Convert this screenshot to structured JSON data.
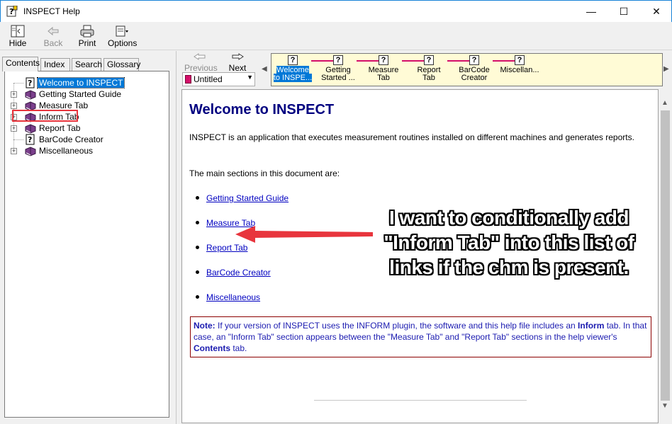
{
  "window": {
    "title": "INSPECT Help",
    "minimize": "—",
    "maximize": "☐",
    "close": "✕"
  },
  "toolbar": {
    "hide": "Hide",
    "back": "Back",
    "print": "Print",
    "options": "Options"
  },
  "left_tabs": [
    "Contents",
    "Index",
    "Search",
    "Glossary"
  ],
  "tree": [
    {
      "label": "Welcome to INSPECT",
      "icon": "page-icon",
      "selected": true
    },
    {
      "label": "Getting Started Guide",
      "icon": "book-icon"
    },
    {
      "label": "Measure Tab",
      "icon": "book-icon"
    },
    {
      "label": "Inform Tab",
      "icon": "book-icon"
    },
    {
      "label": "Report Tab",
      "icon": "book-icon"
    },
    {
      "label": "BarCode Creator",
      "icon": "page-icon"
    },
    {
      "label": "Miscellaneous",
      "icon": "book-icon"
    }
  ],
  "nav": {
    "previous": "Previous",
    "next": "Next",
    "untitled": "Untitled"
  },
  "breadcrumbs": [
    {
      "line1": "Welcome",
      "line2": "to INSPE..."
    },
    {
      "line1": "Getting",
      "line2": "Started ..."
    },
    {
      "line1": "Measure",
      "line2": "Tab"
    },
    {
      "line1": "Report",
      "line2": "Tab"
    },
    {
      "line1": "BarCode",
      "line2": "Creator"
    },
    {
      "line1": "Miscellan...",
      "line2": ""
    }
  ],
  "content": {
    "heading": "Welcome to INSPECT",
    "intro": "INSPECT is an application that executes measurement routines installed on different machines and generates reports.",
    "sections_intro": "The main sections in this document are:",
    "links": [
      "Getting Started Guide",
      "Measure Tab",
      "Report Tab",
      "BarCode Creator",
      "Miscellaneous"
    ],
    "note_label": "Note:",
    "note_text_1": " If your version of INSPECT uses the INFORM plugin, the software and this help file includes an ",
    "note_bold_1": "Inform",
    "note_text_2": " tab. In that case, an \"Inform Tab\" section appears between the \"Measure Tab\" and \"Report Tab\" sections in the help viewer's ",
    "note_bold_2": "Contents",
    "note_text_3": " tab."
  },
  "annotation": {
    "line1": "I want to conditionally add",
    "line2": "\"Inform Tab\" into this list of",
    "line3": "links if the chm is present."
  },
  "colors": {
    "accent": "#d40f6a",
    "link": "#0000c0",
    "heading": "#000080",
    "selection": "#0078d7",
    "arrow": "#e8353d"
  }
}
